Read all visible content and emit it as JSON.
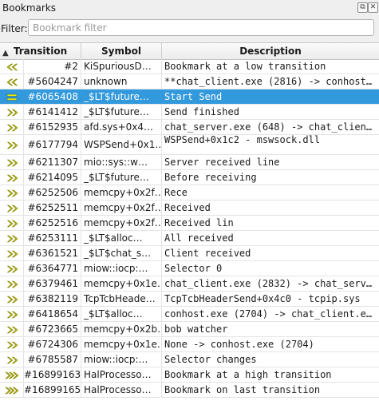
{
  "window": {
    "title": "Bookmarks",
    "float_button": "⧉",
    "close_button": "✕"
  },
  "filter": {
    "label": "Filter:",
    "value": "",
    "placeholder": "Bookmark filter"
  },
  "columns": {
    "transition": "Transition",
    "symbol": "Symbol",
    "description": "Description"
  },
  "colors": {
    "selected_row": "#3399dd",
    "icon_yellow": "#c8c800"
  },
  "rows": [
    {
      "icon": "prev-double-icon",
      "transition": "#2",
      "symbol": "KiSpuriousD…",
      "description": "Bookmark at a low transition"
    },
    {
      "icon": "prev-double-icon",
      "transition": "#5604247",
      "symbol": "unknown",
      "description": "**chat_client.exe (2816) -> conhost…"
    },
    {
      "icon": "equals-icon",
      "transition": "#6065408",
      "symbol": "_$LT$future…",
      "description": "Start Send",
      "selected": true
    },
    {
      "icon": "next-double-icon",
      "transition": "#6141412",
      "symbol": "_$LT$future…",
      "description": "Send finished"
    },
    {
      "icon": "next-double-icon",
      "transition": "#6152935",
      "symbol": "afd.sys+0x4…",
      "description": "chat_server.exe (648) -> chat_clien…"
    },
    {
      "icon": "next-double-icon",
      "transition": "#6177794",
      "symbol": "WSPSend+0x1…",
      "description": "WSPSend+0x1c2 - mswsock.dll",
      "tall": true
    },
    {
      "icon": "next-double-icon",
      "transition": "#6211307",
      "symbol": "mio::sys::w…",
      "description": "Server received line"
    },
    {
      "icon": "next-double-icon",
      "transition": "#6214095",
      "symbol": "_$LT$future…",
      "description": "Before receiving"
    },
    {
      "icon": "next-double-icon",
      "transition": "#6252506",
      "symbol": "memcpy+0x2f…",
      "description": "Rece"
    },
    {
      "icon": "next-double-icon",
      "transition": "#6252511",
      "symbol": "memcpy+0x2f…",
      "description": "Received"
    },
    {
      "icon": "next-double-icon",
      "transition": "#6252516",
      "symbol": "memcpy+0x2f…",
      "description": "Received lin"
    },
    {
      "icon": "next-double-icon",
      "transition": "#6253111",
      "symbol": "_$LT$alloc…",
      "description": "All received"
    },
    {
      "icon": "next-double-icon",
      "transition": "#6361521",
      "symbol": "_$LT$chat_s…",
      "description": "Client received"
    },
    {
      "icon": "next-double-icon",
      "transition": "#6364771",
      "symbol": "miow::iocp:…",
      "description": "Selector 0"
    },
    {
      "icon": "next-double-icon",
      "transition": "#6379461",
      "symbol": "memcpy+0x1e…",
      "description": "chat_client.exe (2832) -> chat_serv…"
    },
    {
      "icon": "next-double-icon",
      "transition": "#6382119",
      "symbol": "TcpTcbHeade…",
      "description": "TcpTcbHeaderSend+0x4c0 - tcpip.sys"
    },
    {
      "icon": "next-double-icon",
      "transition": "#6418654",
      "symbol": "_$LT$alloc…",
      "description": "conhost.exe (2704) -> chat_client.e…"
    },
    {
      "icon": "next-double-icon",
      "transition": "#6723665",
      "symbol": "memcpy+0x2b…",
      "description": "bob watcher"
    },
    {
      "icon": "next-double-icon",
      "transition": "#6724306",
      "symbol": "memcpy+0x1e…",
      "description": "None -> conhost.exe (2704)"
    },
    {
      "icon": "next-double-icon",
      "transition": "#6785587",
      "symbol": "miow::iocp:…",
      "description": "Selector changes"
    },
    {
      "icon": "next-triple-icon",
      "transition": "#16899163",
      "symbol": "HalProcesso…",
      "description": "Bookmark at a high transition"
    },
    {
      "icon": "next-triple-icon",
      "transition": "#16899165",
      "symbol": "HalProcesso…",
      "description": "Bookmark on last transition"
    }
  ]
}
